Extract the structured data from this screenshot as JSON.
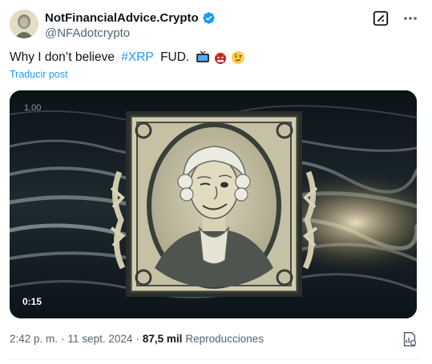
{
  "author": {
    "display_name": "NotFinancialAdvice.Crypto",
    "handle": "@NFAdotcrypto",
    "verified": true
  },
  "tweet": {
    "text_before": "Why I don’t believe ",
    "cashtag": "#XRP",
    "text_after": " FUD.",
    "emojis": [
      "tv-icon",
      "ogre-icon",
      "raised-eyebrow-face-icon"
    ],
    "translate_label": "Traducir post"
  },
  "media": {
    "watermark": "1.00",
    "duration": "0:15"
  },
  "meta": {
    "time": "2:42 p. m.",
    "separator": "·",
    "date": "11 sept. 2024",
    "separator2": "·",
    "views_count": "87,5 mil",
    "views_label": "Reproducciones"
  },
  "colors": {
    "accent": "#1d9bf0",
    "text": "#0f1419",
    "muted": "#536471"
  }
}
